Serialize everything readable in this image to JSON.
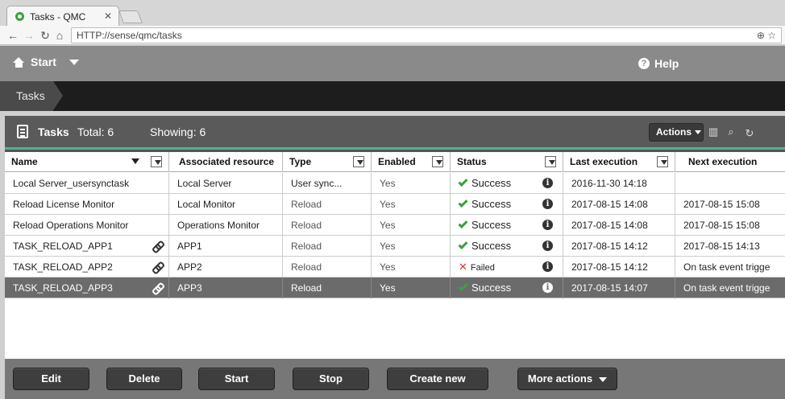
{
  "browser": {
    "tab_title": "Tasks - QMC",
    "url": "HTTP://sense/qmc/tasks"
  },
  "topbar": {
    "start_label": "Start",
    "help_label": "Help"
  },
  "breadcrumb": {
    "current": "Tasks"
  },
  "panel": {
    "title": "Tasks",
    "total": "Total: 6",
    "showing": "Showing: 6",
    "actions_label": "Actions"
  },
  "table": {
    "columns": [
      "Name",
      "Associated resource",
      "Type",
      "Enabled",
      "Status",
      "Last execution",
      "Next execution"
    ],
    "rows": [
      {
        "name": "Local Server_usersynctask",
        "resource": "Local Server",
        "type": "User sync...",
        "enabled": "Yes",
        "status": "Success",
        "last": "2016-11-30 14:18",
        "next": ""
      },
      {
        "name": "Reload License Monitor",
        "resource": "Local Monitor",
        "type": "Reload",
        "enabled": "Yes",
        "status": "Success",
        "last": "2017-08-15 14:08",
        "next": "2017-08-15 15:08"
      },
      {
        "name": "Reload Operations Monitor",
        "resource": "Operations Monitor",
        "type": "Reload",
        "enabled": "Yes",
        "status": "Success",
        "last": "2017-08-15 14:08",
        "next": "2017-08-15 15:08"
      },
      {
        "name": "TASK_RELOAD_APP1",
        "resource": "APP1",
        "type": "Reload",
        "enabled": "Yes",
        "status": "Success",
        "last": "2017-08-15 14:12",
        "next": "2017-08-15 14:13"
      },
      {
        "name": "TASK_RELOAD_APP2",
        "resource": "APP2",
        "type": "Reload",
        "enabled": "Yes",
        "status": "Failed",
        "last": "2017-08-15 14:12",
        "next": "On task event trigge"
      },
      {
        "name": "TASK_RELOAD_APP3",
        "resource": "APP3",
        "type": "Reload",
        "enabled": "Yes",
        "status": "Success",
        "last": "2017-08-15 14:07",
        "next": "On task event trigge"
      }
    ]
  },
  "buttons": {
    "edit": "Edit",
    "delete": "Delete",
    "start": "Start",
    "stop": "Stop",
    "create_new": "Create new",
    "more_actions": "More actions"
  },
  "colors": {
    "accent": "#4fb58f",
    "success": "#3aa040",
    "failed": "#d33333",
    "selected_row": "#6b6b6b"
  }
}
